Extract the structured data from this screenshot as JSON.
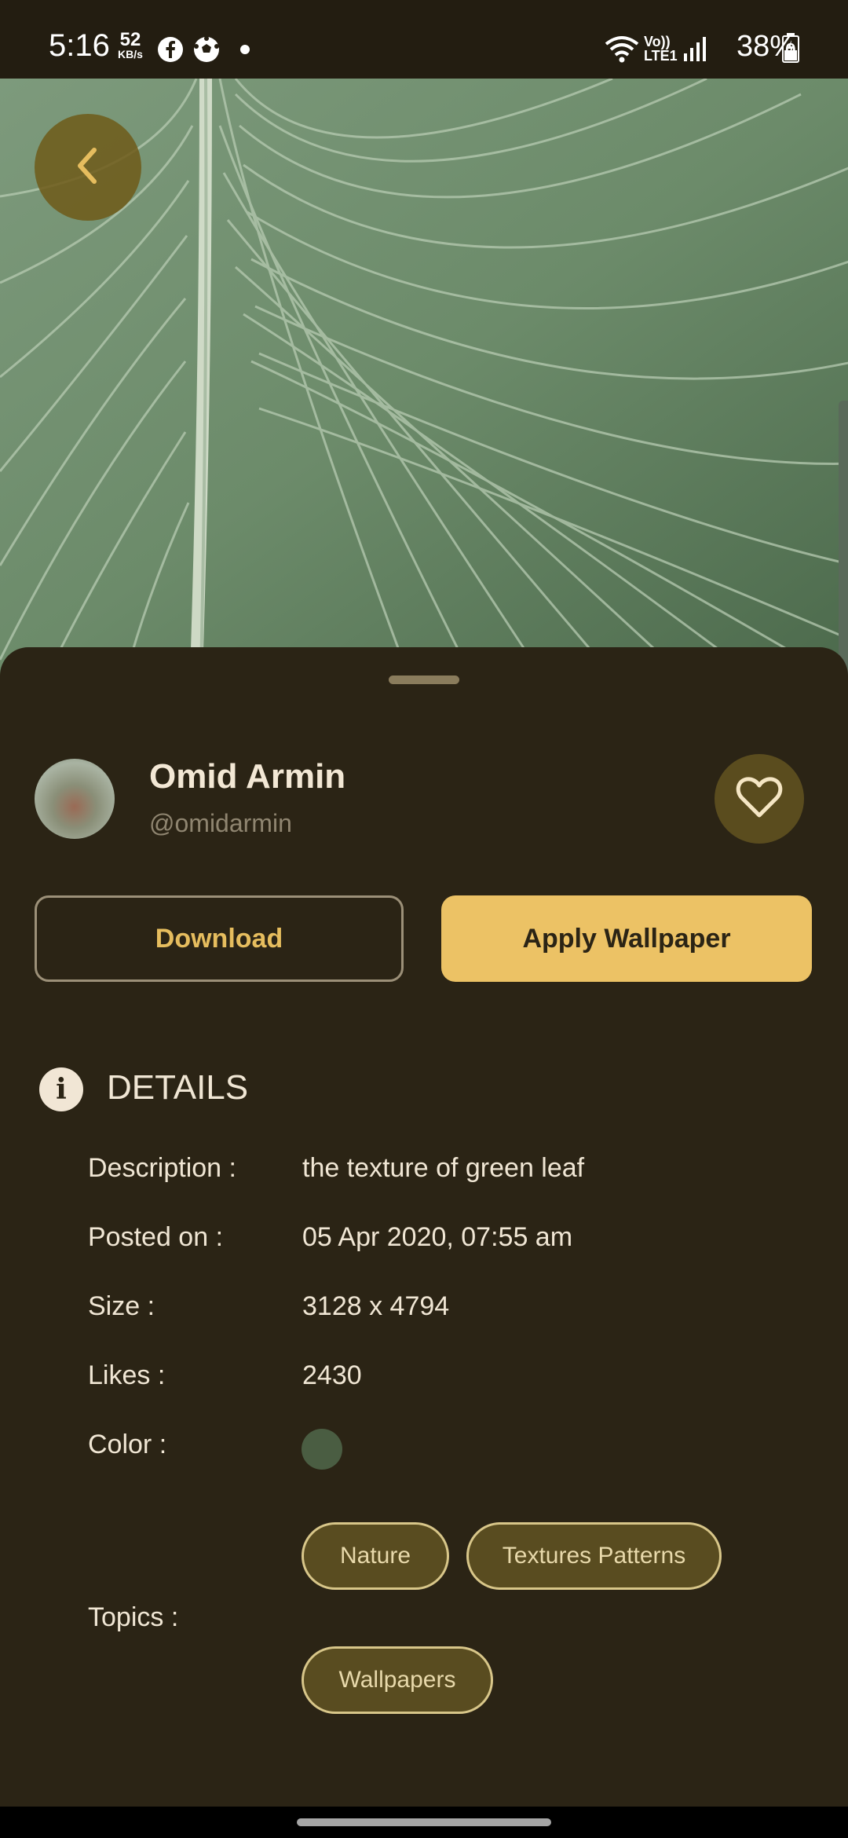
{
  "status_bar": {
    "time": "5:16",
    "speed_value": "52",
    "speed_unit": "KB/s",
    "network_label": "Vo)) LTE1",
    "battery": "38%"
  },
  "author": {
    "name": "Omid Armin",
    "handle": "@omidarmin"
  },
  "actions": {
    "download_label": "Download",
    "apply_label": "Apply Wallpaper"
  },
  "details": {
    "title": "DETAILS",
    "info_glyph": "i",
    "description_label": "Description :",
    "description_value": "the texture of green leaf",
    "posted_label": "Posted on :",
    "posted_value": "05 Apr 2020, 07:55 am",
    "size_label": "Size :",
    "size_value": "3128 x 4794",
    "likes_label": "Likes :",
    "likes_value": "2430",
    "color_label": "Color :",
    "color_value": "#4a5d42",
    "topics_label": "Topics :",
    "topics": [
      "Nature",
      "Textures Patterns",
      "Wallpapers"
    ]
  },
  "colors": {
    "accent": "#ecc265",
    "sheet_bg": "#2b2415",
    "chip_bg": "#594c20"
  },
  "icons": [
    "back-chevron-icon",
    "heart-icon",
    "info-icon",
    "facebook-icon",
    "soccer-ball-icon",
    "wifi-icon",
    "signal-icon",
    "battery-icon"
  ]
}
